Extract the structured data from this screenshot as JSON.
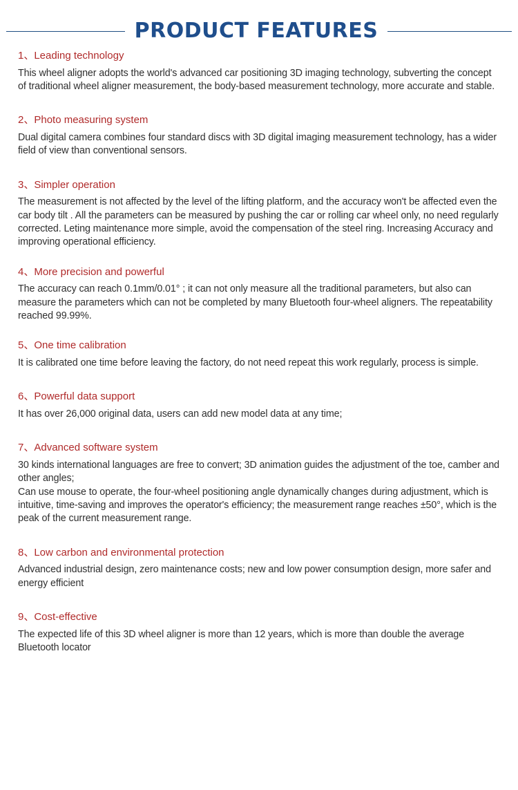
{
  "header": {
    "title": "PRODUCT FEATURES",
    "rule_color": "#1f4e82",
    "title_color": "#1f4e8c"
  },
  "theme": {
    "background": "#ffffff",
    "heading_color": "#b02a2a",
    "body_color": "#2f2f2f"
  },
  "features": [
    {
      "number": "1、",
      "title": "Leading technology",
      "body": "This wheel aligner adopts the world's advanced car positioning 3D imaging technology, subverting the concept of traditional wheel aligner measurement, the body-based measurement technology, more accurate and stable."
    },
    {
      "number": "2、",
      "title": "Photo measuring system",
      "body": "Dual digital camera combines four standard discs with 3D digital imaging measurement technology, has a wider field of view than conventional sensors."
    },
    {
      "number": "3、",
      "title": "Simpler operation",
      "body": "The measurement is not affected by the level of the lifting platform, and the accuracy won't be affected even the car body tilt . All the parameters can be measured by pushing the car or rolling car wheel only, no need regularly corrected. Leting maintenance more simple, avoid the compensation of the steel ring. Increasing Accuracy and improving operational efficiency."
    },
    {
      "number": "4、",
      "title": "More precision and powerful",
      "body": "The accuracy can reach 0.1mm/0.01° ; it can not only measure all the traditional parameters, but also can measure the parameters which can not be completed by many Bluetooth four-wheel aligners. The repeatability reached 99.99%."
    },
    {
      "number": "5、",
      "title": "One time calibration",
      "body": "It is calibrated one time  before leaving the factory, do not need repeat this work regularly,  process is simple."
    },
    {
      "number": "6、",
      "title": "Powerful data support",
      "body": "It has over 26,000 original data, users can add new model data at any time;"
    },
    {
      "number": "7、",
      "title": "Advanced software system",
      "body": "30 kinds international languages are free to convert; 3D animation guides the adjustment of the toe, camber and other angles;\nCan use mouse to operate, the four-wheel positioning angle dynamically changes during adjustment, which is intuitive, time-saving and improves the operator's efficiency; the measurement range reaches ±50°, which is the peak of the current measurement range."
    },
    {
      "number": "8、",
      "title": "Low carbon and environmental protection",
      "body": "Advanced industrial design, zero maintenance costs; new and low power consumption design, more safer and energy efficient"
    },
    {
      "number": "9、",
      "title": "Cost-effective",
      "body": "The expected life of this 3D wheel aligner is more than 12 years, which is more than double the average Bluetooth locator"
    }
  ]
}
